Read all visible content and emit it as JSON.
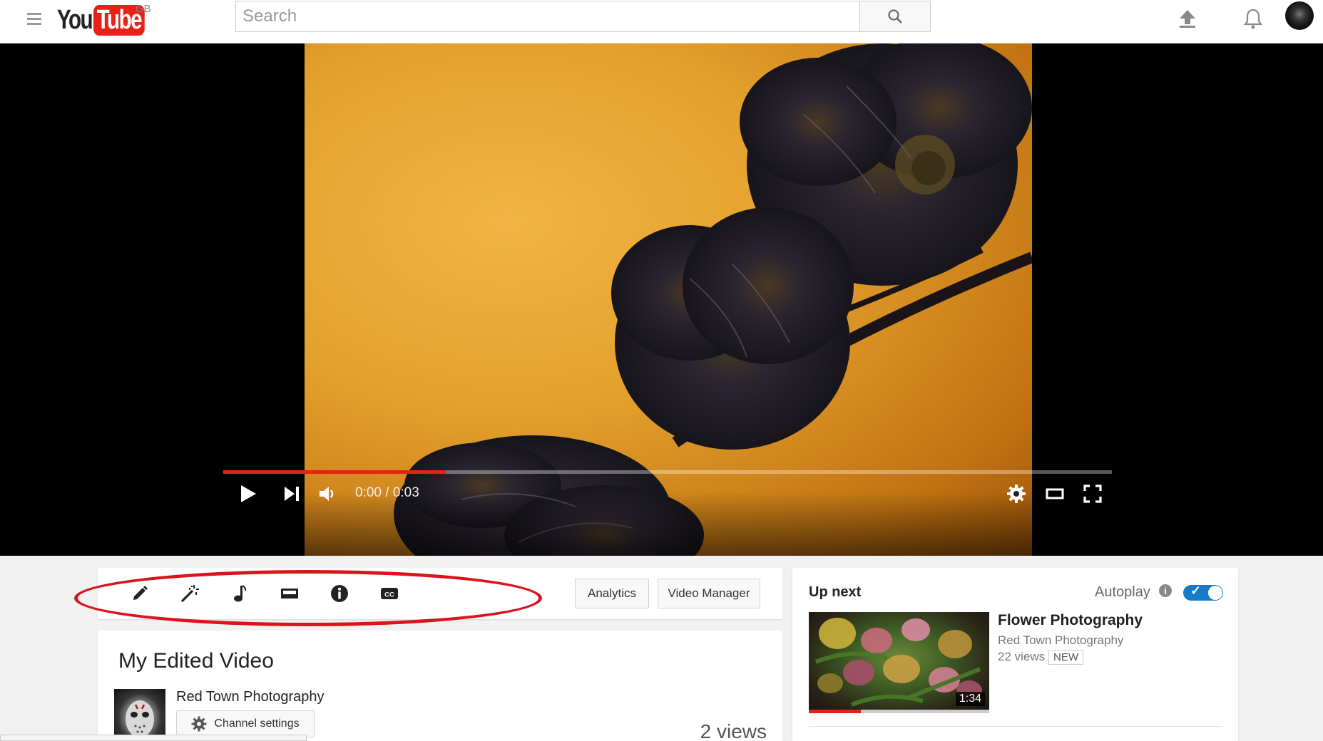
{
  "masthead": {
    "logo_you": "You",
    "logo_tube": "Tube",
    "region": "GB",
    "search_placeholder": "Search",
    "upload_icon": "upload-icon",
    "notifications_icon": "bell-icon"
  },
  "player": {
    "current_time": "0:00",
    "duration": "0:03",
    "time_display": "0:00 / 0:03",
    "played_fraction": 0.25,
    "loaded_fraction": 0.25,
    "icons": [
      "play-icon",
      "next-icon",
      "volume-icon",
      "settings-icon",
      "theater-mode-icon",
      "fullscreen-icon"
    ]
  },
  "toolbar": {
    "tools": [
      "edit-icon",
      "enhancements-icon",
      "audio-icon",
      "end-screen-icon",
      "info-cards-icon",
      "subtitles-icon"
    ],
    "analytics_label": "Analytics",
    "video_manager_label": "Video Manager",
    "highlight_color": "#d9141b"
  },
  "video_info": {
    "title": "My Edited Video",
    "channel_name": "Red Town Photography",
    "channel_settings_label": "Channel settings",
    "views": "2 views"
  },
  "up_next": {
    "heading": "Up next",
    "autoplay_label": "Autoplay",
    "autoplay_on": true,
    "video": {
      "title": "Flower Photography",
      "channel": "Red Town Photography",
      "views": "22 views",
      "badge": "NEW",
      "duration": "1:34",
      "watched_fraction": 0.29
    }
  },
  "colors": {
    "brand_red": "#e62117",
    "toggle_blue": "#167ac6"
  }
}
